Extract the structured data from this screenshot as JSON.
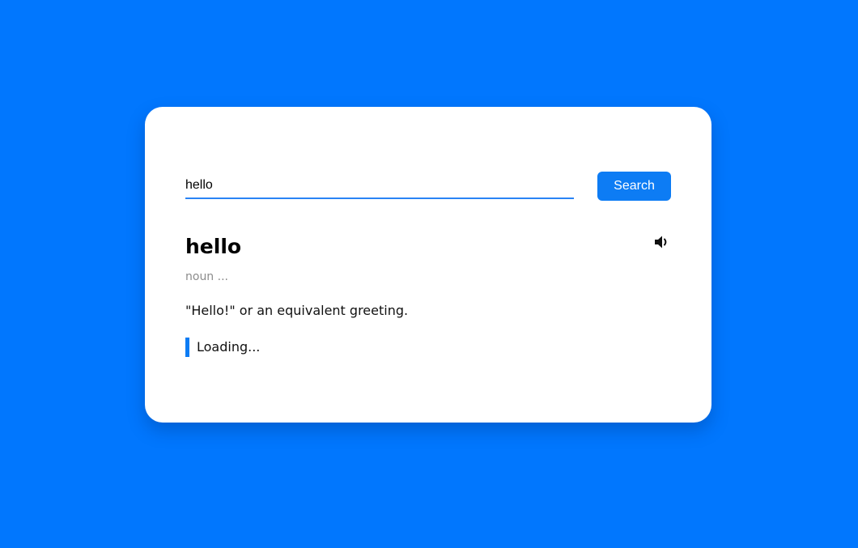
{
  "search": {
    "value": "hello",
    "button_label": "Search"
  },
  "result": {
    "word": "hello",
    "part_of_speech": "noun ...",
    "definition": "\"Hello!\" or an equivalent greeting.",
    "example": "Loading..."
  },
  "icons": {
    "pronunciation": "speaker-volume-icon"
  },
  "colors": {
    "background": "#0177fe",
    "accent": "#0d7cf4",
    "card": "#ffffff"
  }
}
